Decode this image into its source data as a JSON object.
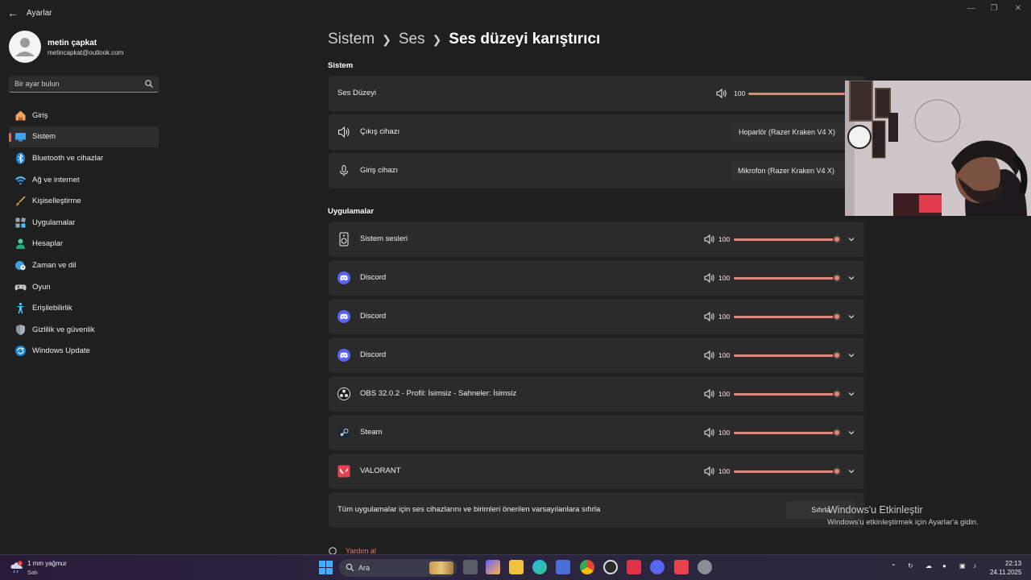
{
  "window": {
    "title": "Ayarlar"
  },
  "profile": {
    "name": "metin çapkat",
    "email": "metincapkat@outlook.com"
  },
  "search": {
    "placeholder": "Bir ayar bulun"
  },
  "sidebar": {
    "items": [
      {
        "label": "Giriş",
        "icon": "home-icon"
      },
      {
        "label": "Sistem",
        "icon": "system-icon",
        "active": true
      },
      {
        "label": "Bluetooth ve cihazlar",
        "icon": "bluetooth-icon"
      },
      {
        "label": "Ağ ve internet",
        "icon": "wifi-icon"
      },
      {
        "label": "Kişiselleştirme",
        "icon": "brush-icon"
      },
      {
        "label": "Uygulamalar",
        "icon": "apps-icon"
      },
      {
        "label": "Hesaplar",
        "icon": "person-icon"
      },
      {
        "label": "Zaman ve dil",
        "icon": "globe-clock-icon"
      },
      {
        "label": "Oyun",
        "icon": "gamepad-icon"
      },
      {
        "label": "Erişilebilirlik",
        "icon": "accessibility-icon"
      },
      {
        "label": "Gizlilik ve güvenlik",
        "icon": "shield-icon"
      },
      {
        "label": "Windows Update",
        "icon": "update-icon"
      }
    ]
  },
  "breadcrumb": {
    "item1": "Sistem",
    "item2": "Ses",
    "current": "Ses düzeyi karıştırıcı"
  },
  "system_section": {
    "heading": "Sistem",
    "volume_label": "Ses Düzeyi",
    "volume_value": "100",
    "volume_level": 1.0,
    "output_label": "Çıkış cihazı",
    "output_device": "Hoparlör (Razer Kraken V4 X)",
    "input_label": "Giriş cihazı",
    "input_device": "Mikrofon (Razer Kraken V4 X)"
  },
  "apps_section": {
    "heading": "Uygulamalar",
    "apps": [
      {
        "name": "Sistem sesleri",
        "volume": "100",
        "level": 1.0,
        "icon": "system-sounds-icon"
      },
      {
        "name": "Discord",
        "volume": "100",
        "level": 1.0,
        "icon": "discord-icon"
      },
      {
        "name": "Discord",
        "volume": "100",
        "level": 1.0,
        "icon": "discord-icon"
      },
      {
        "name": "Discord",
        "volume": "100",
        "level": 1.0,
        "icon": "discord-icon"
      },
      {
        "name": "OBS 32.0.2 - Profil: İsimsiz - Sahneler: İsimsiz",
        "volume": "100",
        "level": 1.0,
        "icon": "obs-icon"
      },
      {
        "name": "Steam",
        "volume": "100",
        "level": 1.0,
        "icon": "steam-icon"
      },
      {
        "name": "VALORANT",
        "volume": "100",
        "level": 1.0,
        "icon": "valorant-icon"
      }
    ],
    "reset_text": "Tüm uygulamalar için ses cihazlarını ve birimleri önerilen varsayılanlara sıfırla",
    "reset_button": "Sıfırla"
  },
  "help": {
    "label": "Yardım al"
  },
  "watermark": {
    "title": "Windows'u Etkinleştir",
    "subtitle": "Windows'u etkinleştirmek için Ayarlar'a gidin."
  },
  "taskbar": {
    "weather_line1": "1 mm yağmur",
    "weather_line2": "Salı",
    "weather_badge": "1",
    "search_label": "Ara",
    "time": "22:13",
    "date": "24.11.2025"
  },
  "colors": {
    "accent": "#e2837a",
    "card_bg": "#2b2b2b",
    "page_bg": "#1f1f1f",
    "discord": "#5865f2",
    "valorant": "#e8424f"
  }
}
